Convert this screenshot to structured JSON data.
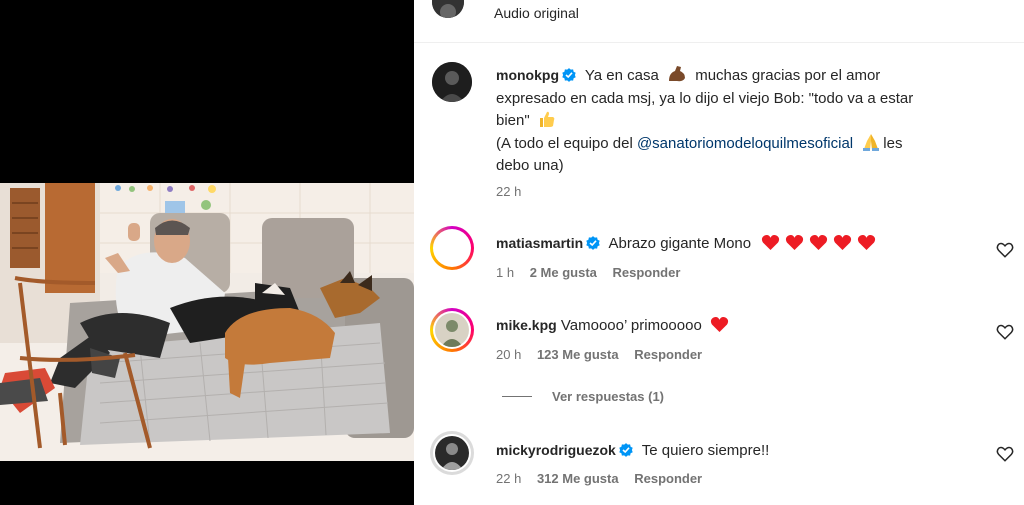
{
  "header": {
    "audio_label": "Audio original"
  },
  "post": {
    "username": "monokpg",
    "caption_lines": [
      "Ya en casa",
      "muchas gracias por el amor",
      "expresado en cada msj, ya lo dijo el viejo Bob: \"todo va a estar",
      "bien\"",
      "(A todo el equipo del ",
      "@sanatoriomodeloquilmesoficial",
      "les",
      "debo una)"
    ],
    "time": "22 h"
  },
  "comments": [
    {
      "username": "matiasmartin",
      "verified": true,
      "text": "Abrazo gigante Mono",
      "hearts": 5,
      "time": "1 h",
      "likes": "2 Me gusta",
      "reply": "Responder"
    },
    {
      "username": "mike.kpg",
      "verified": false,
      "text": "Vamoooo’ primooooo",
      "hearts": 1,
      "time": "20 h",
      "likes": "123 Me gusta",
      "reply": "Responder"
    },
    {
      "username": "mickyrodriguezok",
      "verified": true,
      "text": "Te quiero siempre!!",
      "hearts": 0,
      "time": "22 h",
      "likes": "312 Me gusta",
      "reply": "Responder"
    }
  ],
  "view_replies": "Ver respuestas (1)",
  "colors": {
    "verified": "#0095f6",
    "heart": "#ed1c24",
    "secondary_text": "#737373",
    "mention": "#00376b"
  },
  "icons": [
    "more-icon",
    "verified-badge-icon",
    "heart-outline-icon",
    "red-heart-emoji",
    "flexed-biceps-emoji",
    "thumbs-up-emoji",
    "folded-hands-emoji"
  ]
}
